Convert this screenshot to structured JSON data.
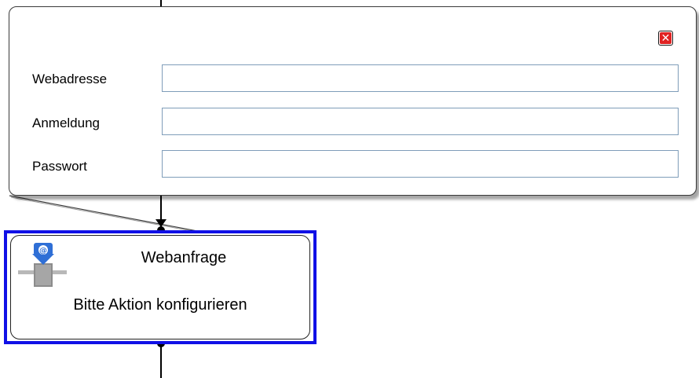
{
  "popup": {
    "close_symbol": "✕",
    "fields": [
      {
        "label": "Webadresse",
        "value": "",
        "placeholder": ""
      },
      {
        "label": "Anmeldung",
        "value": "",
        "placeholder": ""
      },
      {
        "label": "Passwort",
        "value": "",
        "placeholder": ""
      }
    ]
  },
  "node": {
    "title": "Webanfrage",
    "subtitle": "Bitte Aktion konfigurieren",
    "icon": "web-request-icon",
    "selection_color": "#1010e6"
  },
  "colors": {
    "close_button": "#e02323",
    "input_border": "#7f9db9",
    "connector": "#000000"
  }
}
